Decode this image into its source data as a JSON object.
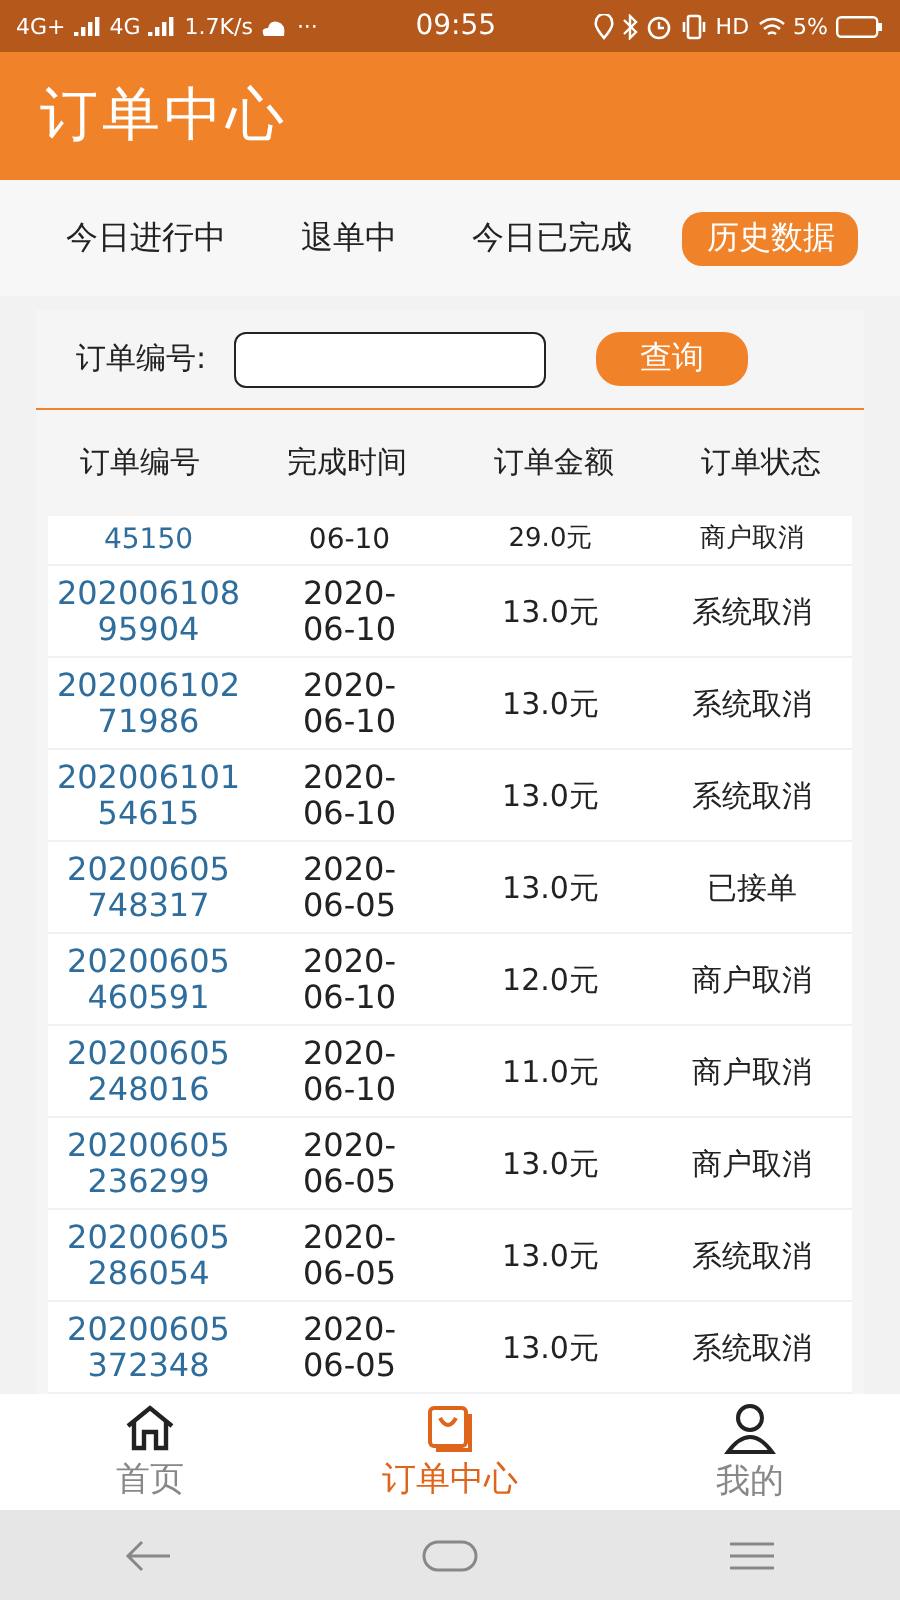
{
  "status_bar": {
    "network_1": "4G+",
    "network_2": "4G",
    "speed": "1.7K/s",
    "more": "···",
    "time": "09:55",
    "hd": "HD",
    "battery": "5%"
  },
  "header": {
    "title": "订单中心"
  },
  "tabs": [
    {
      "label": "今日进行中",
      "selected": false
    },
    {
      "label": "退单中",
      "selected": false
    },
    {
      "label": "今日已完成",
      "selected": false
    },
    {
      "label": "历史数据",
      "selected": true
    }
  ],
  "search": {
    "label": "订单编号:",
    "button": "查询"
  },
  "table": {
    "columns": [
      "订单编号",
      "完成时间",
      "订单金额",
      "订单状态"
    ],
    "rows": [
      {
        "kind": "partial",
        "order": [
          "45150"
        ],
        "time": [
          "06-10"
        ],
        "amount": "29.0元",
        "status": "商户取消"
      },
      {
        "kind": "full",
        "order": [
          "202006108",
          "95904"
        ],
        "time": [
          "2020-",
          "06-10"
        ],
        "amount": "13.0元",
        "status": "系统取消"
      },
      {
        "kind": "full",
        "order": [
          "202006102",
          "71986"
        ],
        "time": [
          "2020-",
          "06-10"
        ],
        "amount": "13.0元",
        "status": "系统取消"
      },
      {
        "kind": "full",
        "order": [
          "202006101",
          "54615"
        ],
        "time": [
          "2020-",
          "06-10"
        ],
        "amount": "13.0元",
        "status": "系统取消"
      },
      {
        "kind": "full",
        "order": [
          "20200605",
          "748317"
        ],
        "time": [
          "2020-",
          "06-05"
        ],
        "amount": "13.0元",
        "status": "已接单"
      },
      {
        "kind": "full",
        "order": [
          "20200605",
          "460591"
        ],
        "time": [
          "2020-",
          "06-10"
        ],
        "amount": "12.0元",
        "status": "商户取消"
      },
      {
        "kind": "full",
        "order": [
          "20200605",
          "248016"
        ],
        "time": [
          "2020-",
          "06-10"
        ],
        "amount": "11.0元",
        "status": "商户取消"
      },
      {
        "kind": "full",
        "order": [
          "20200605",
          "236299"
        ],
        "time": [
          "2020-",
          "06-05"
        ],
        "amount": "13.0元",
        "status": "商户取消"
      },
      {
        "kind": "full",
        "order": [
          "20200605",
          "286054"
        ],
        "time": [
          "2020-",
          "06-05"
        ],
        "amount": "13.0元",
        "status": "系统取消"
      },
      {
        "kind": "full",
        "order": [
          "20200605",
          "372348"
        ],
        "time": [
          "2020-",
          "06-05"
        ],
        "amount": "13.0元",
        "status": "系统取消"
      }
    ]
  },
  "bottom_nav": [
    {
      "label": "首页",
      "kind": "home",
      "selected": false
    },
    {
      "label": "订单中心",
      "kind": "orders",
      "selected": true
    },
    {
      "label": "我的",
      "kind": "profile",
      "selected": false
    }
  ]
}
